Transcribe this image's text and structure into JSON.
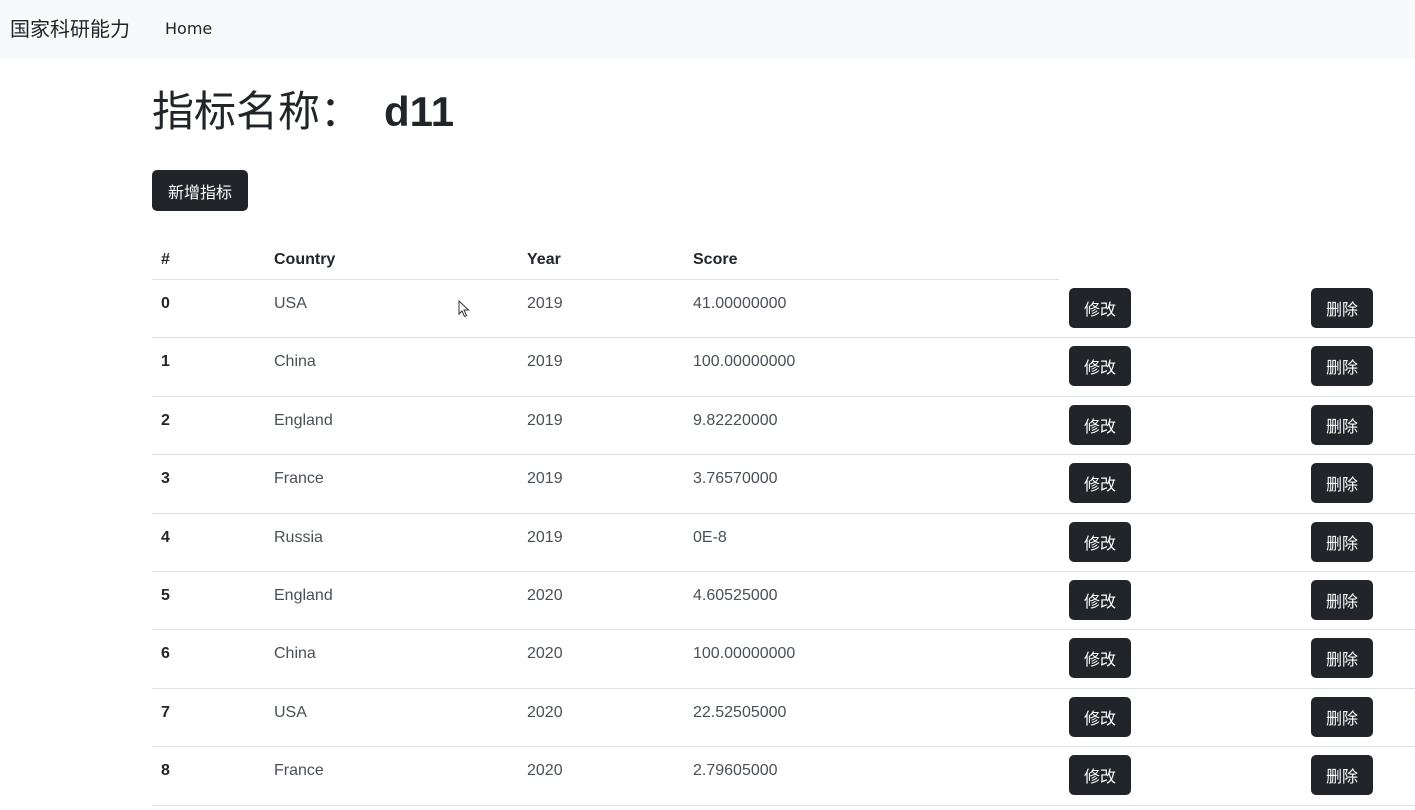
{
  "navbar": {
    "brand": "国家科研能力",
    "home": "Home"
  },
  "title": {
    "label": "指标名称：",
    "value": "d11"
  },
  "add_button": "新增指标",
  "table": {
    "headers": [
      "#",
      "Country",
      "Year",
      "Score"
    ],
    "rows": [
      {
        "idx": "0",
        "country": "USA",
        "year": "2019",
        "score": "41.00000000"
      },
      {
        "idx": "1",
        "country": "China",
        "year": "2019",
        "score": "100.00000000"
      },
      {
        "idx": "2",
        "country": "England",
        "year": "2019",
        "score": "9.82220000"
      },
      {
        "idx": "3",
        "country": "France",
        "year": "2019",
        "score": "3.76570000"
      },
      {
        "idx": "4",
        "country": "Russia",
        "year": "2019",
        "score": "0E-8"
      },
      {
        "idx": "5",
        "country": "England",
        "year": "2020",
        "score": "4.60525000"
      },
      {
        "idx": "6",
        "country": "China",
        "year": "2020",
        "score": "100.00000000"
      },
      {
        "idx": "7",
        "country": "USA",
        "year": "2020",
        "score": "22.52505000"
      },
      {
        "idx": "8",
        "country": "France",
        "year": "2020",
        "score": "2.79605000"
      }
    ],
    "edit_label": "修改",
    "delete_label": "删除"
  }
}
